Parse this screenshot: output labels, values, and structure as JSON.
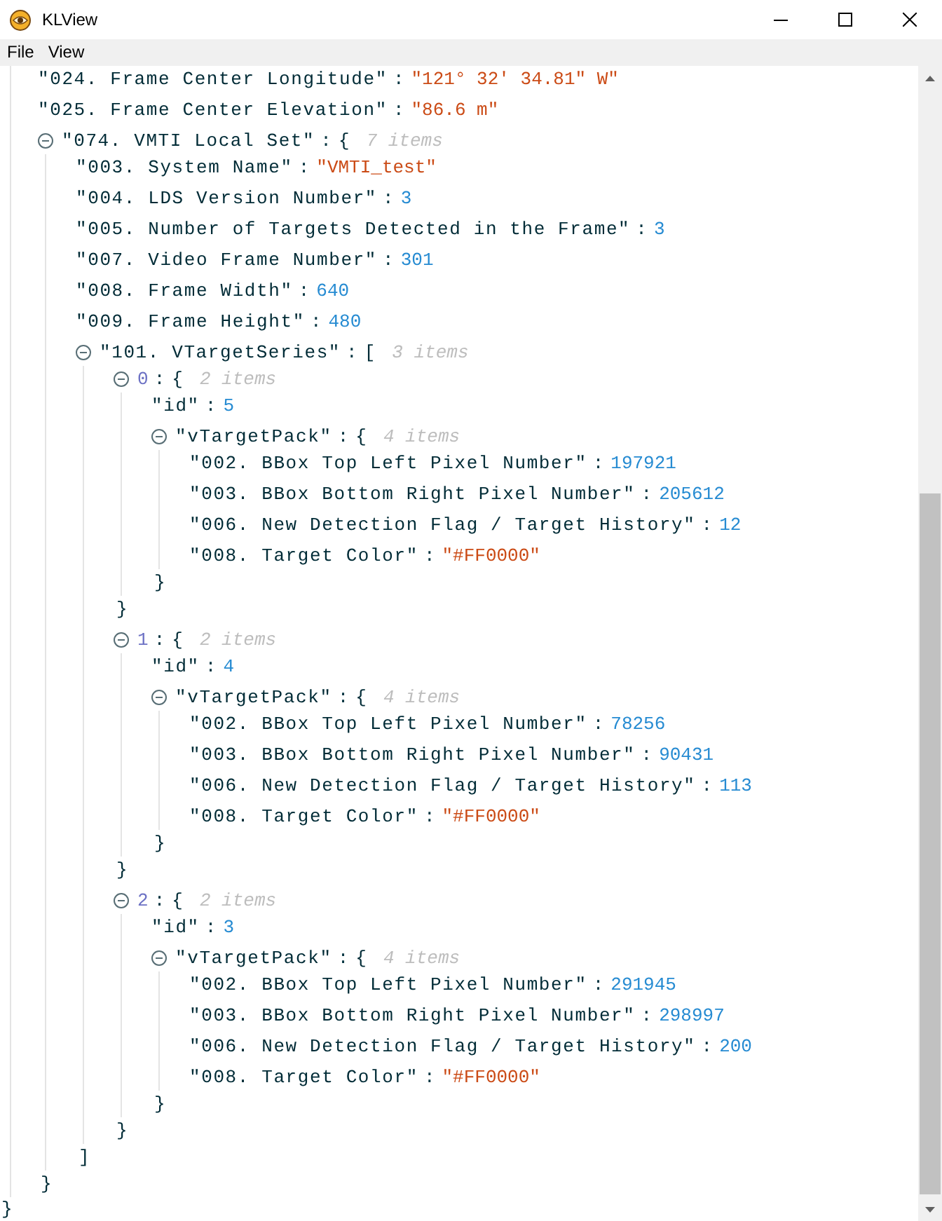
{
  "window": {
    "title": "KLView"
  },
  "menu": [
    {
      "label": "File"
    },
    {
      "label": "View"
    }
  ],
  "tree": {
    "close": "}",
    "children": [
      {
        "kind": "string",
        "key": "\"024. Frame Center Longitude\"",
        "colon": ":",
        "value": "\"121° 32' 34.81\" W\""
      },
      {
        "kind": "string",
        "key": "\"025. Frame Center Elevation\"",
        "colon": ":",
        "value": "\"86.6 m\""
      },
      {
        "kind": "object",
        "key": "\"074. VMTI Local Set\"",
        "colon": ":",
        "open": "{",
        "size": "7 items",
        "expanded": true,
        "close": "}",
        "children": [
          {
            "kind": "string",
            "key": "\"003. System Name\"",
            "colon": ":",
            "value": "\"VMTI_test\""
          },
          {
            "kind": "number",
            "key": "\"004. LDS Version Number\"",
            "colon": ":",
            "value": "3"
          },
          {
            "kind": "number",
            "key": "\"005. Number of Targets Detected in the Frame\"",
            "colon": ":",
            "value": "3"
          },
          {
            "kind": "number",
            "key": "\"007. Video Frame Number\"",
            "colon": ":",
            "value": "301"
          },
          {
            "kind": "number",
            "key": "\"008. Frame Width\"",
            "colon": ":",
            "value": "640"
          },
          {
            "kind": "number",
            "key": "\"009. Frame Height\"",
            "colon": ":",
            "value": "480"
          },
          {
            "kind": "array",
            "key": "\"101. VTargetSeries\"",
            "colon": ":",
            "open": "[",
            "size": "3 items",
            "expanded": true,
            "close": "]",
            "children": [
              {
                "kind": "object",
                "key": "0",
                "colon": ":",
                "open": "{",
                "size": "2 items",
                "expanded": true,
                "close": "}",
                "children": [
                  {
                    "kind": "number",
                    "key": "\"id\"",
                    "colon": ":",
                    "value": "5"
                  },
                  {
                    "kind": "object",
                    "key": "\"vTargetPack\"",
                    "colon": ":",
                    "open": "{",
                    "size": "4 items",
                    "expanded": true,
                    "close": "}",
                    "children": [
                      {
                        "kind": "number",
                        "key": "\"002. BBox Top Left Pixel Number\"",
                        "colon": ":",
                        "value": "197921"
                      },
                      {
                        "kind": "number",
                        "key": "\"003. BBox Bottom Right Pixel Number\"",
                        "colon": ":",
                        "value": "205612"
                      },
                      {
                        "kind": "number",
                        "key": "\"006. New Detection Flag / Target History\"",
                        "colon": ":",
                        "value": "12"
                      },
                      {
                        "kind": "string",
                        "key": "\"008. Target Color\"",
                        "colon": ":",
                        "value": "\"#FF0000\""
                      }
                    ]
                  }
                ]
              },
              {
                "kind": "object",
                "key": "1",
                "colon": ":",
                "open": "{",
                "size": "2 items",
                "expanded": true,
                "close": "}",
                "children": [
                  {
                    "kind": "number",
                    "key": "\"id\"",
                    "colon": ":",
                    "value": "4"
                  },
                  {
                    "kind": "object",
                    "key": "\"vTargetPack\"",
                    "colon": ":",
                    "open": "{",
                    "size": "4 items",
                    "expanded": true,
                    "close": "}",
                    "children": [
                      {
                        "kind": "number",
                        "key": "\"002. BBox Top Left Pixel Number\"",
                        "colon": ":",
                        "value": "78256"
                      },
                      {
                        "kind": "number",
                        "key": "\"003. BBox Bottom Right Pixel Number\"",
                        "colon": ":",
                        "value": "90431"
                      },
                      {
                        "kind": "number",
                        "key": "\"006. New Detection Flag / Target History\"",
                        "colon": ":",
                        "value": "113"
                      },
                      {
                        "kind": "string",
                        "key": "\"008. Target Color\"",
                        "colon": ":",
                        "value": "\"#FF0000\""
                      }
                    ]
                  }
                ]
              },
              {
                "kind": "object",
                "key": "2",
                "colon": ":",
                "open": "{",
                "size": "2 items",
                "expanded": true,
                "close": "}",
                "children": [
                  {
                    "kind": "number",
                    "key": "\"id\"",
                    "colon": ":",
                    "value": "3"
                  },
                  {
                    "kind": "object",
                    "key": "\"vTargetPack\"",
                    "colon": ":",
                    "open": "{",
                    "size": "4 items",
                    "expanded": true,
                    "close": "}",
                    "children": [
                      {
                        "kind": "number",
                        "key": "\"002. BBox Top Left Pixel Number\"",
                        "colon": ":",
                        "value": "291945"
                      },
                      {
                        "kind": "number",
                        "key": "\"003. BBox Bottom Right Pixel Number\"",
                        "colon": ":",
                        "value": "298997"
                      },
                      {
                        "kind": "number",
                        "key": "\"006. New Detection Flag / Target History\"",
                        "colon": ":",
                        "value": "200"
                      },
                      {
                        "kind": "string",
                        "key": "\"008. Target Color\"",
                        "colon": ":",
                        "value": "\"#FF0000\""
                      }
                    ]
                  }
                ]
              }
            ]
          }
        ]
      }
    ]
  }
}
